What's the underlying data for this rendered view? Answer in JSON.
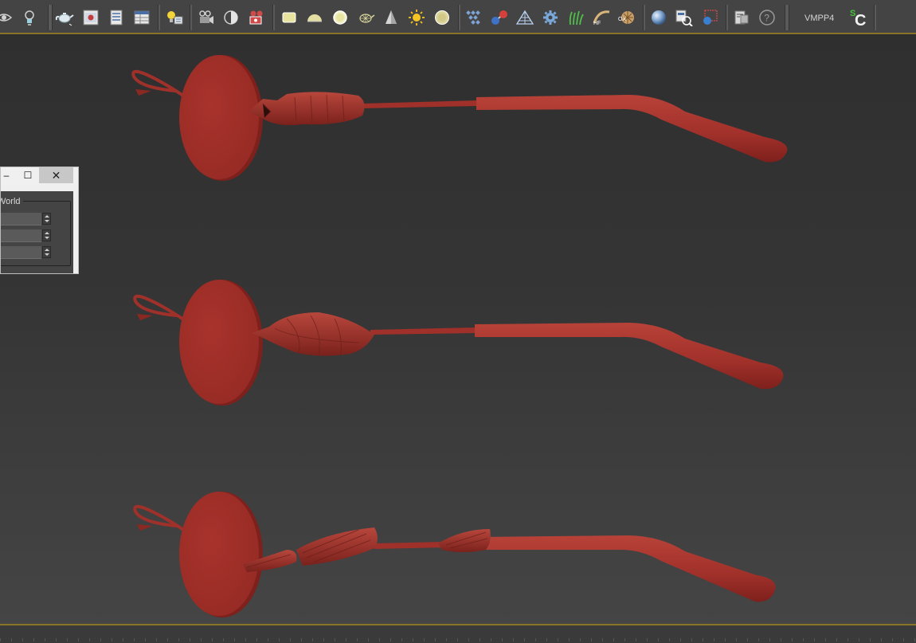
{
  "toolbar": {
    "plugin_label": "VMPP4",
    "logo_label": "SC",
    "tools": [
      {
        "name": "eye-tool",
        "icon": "eye-icon"
      },
      {
        "name": "light-bulb-tool",
        "icon": "light-bulb-icon"
      },
      {
        "name": "teapot-tool",
        "icon": "teapot-icon"
      },
      {
        "name": "render-frame-tool",
        "icon": "render-frame-icon"
      },
      {
        "name": "render-setup-tool",
        "icon": "render-setup-icon"
      },
      {
        "name": "table-tool",
        "icon": "table-icon"
      },
      {
        "name": "light-lister-tool",
        "icon": "light-lister-icon"
      },
      {
        "name": "camera-tool",
        "icon": "camera-icon"
      },
      {
        "name": "dome-light-tool",
        "icon": "dome-icon"
      },
      {
        "name": "film-camera-tool",
        "icon": "film-camera-icon"
      },
      {
        "name": "plane-light-tool",
        "icon": "plane-icon"
      },
      {
        "name": "hemisphere-tool",
        "icon": "hemisphere-icon"
      },
      {
        "name": "sphere-light-tool",
        "icon": "sphere-light-icon"
      },
      {
        "name": "mesh-light-tool",
        "icon": "mesh-light-icon"
      },
      {
        "name": "cone-light-tool",
        "icon": "cone-icon"
      },
      {
        "name": "sun-light-tool",
        "icon": "sun-icon"
      },
      {
        "name": "ies-light-tool",
        "icon": "disc-icon"
      },
      {
        "name": "proxy-tool",
        "icon": "proxy-icon"
      },
      {
        "name": "molecule-tool",
        "icon": "molecule-icon"
      },
      {
        "name": "plane-grid-tool",
        "icon": "plane-grid-icon"
      },
      {
        "name": "gear-tool",
        "icon": "gear-icon"
      },
      {
        "name": "fur-tool",
        "icon": "grass-icon"
      },
      {
        "name": "hf-tool",
        "icon": "hf-icon"
      },
      {
        "name": "ox-tool",
        "icon": "ox-icon"
      },
      {
        "name": "material-sphere-tool",
        "icon": "sphere-icon"
      },
      {
        "name": "material-browser-tool",
        "icon": "material-browser-icon"
      },
      {
        "name": "render-region-tool",
        "icon": "render-region-icon"
      },
      {
        "name": "log-tool",
        "icon": "log-icon"
      },
      {
        "name": "help-tool",
        "icon": "help-icon"
      }
    ]
  },
  "dialog": {
    "minimize_label": "–",
    "maximize_label": "☐",
    "close_label": "✕",
    "group_label": "World",
    "fields": [
      {
        "name": "x-spinner",
        "value": ""
      },
      {
        "name": "y-spinner",
        "value": ""
      },
      {
        "name": "z-spinner",
        "value": ""
      }
    ]
  },
  "viewport": {
    "object_color": "#a0302a",
    "objects": [
      {
        "name": "glasses-temple-variant-1",
        "ornament": "owl-bust"
      },
      {
        "name": "glasses-temple-variant-2",
        "ornament": "bird-body"
      },
      {
        "name": "glasses-temple-variant-3",
        "ornament": "feather-wings"
      }
    ]
  },
  "colors": {
    "toolbar_bg": "#444444",
    "accent_line": "#8a7428",
    "object": "#a0302a",
    "object_shadow": "#7e201c",
    "object_highlight": "#b84238"
  }
}
